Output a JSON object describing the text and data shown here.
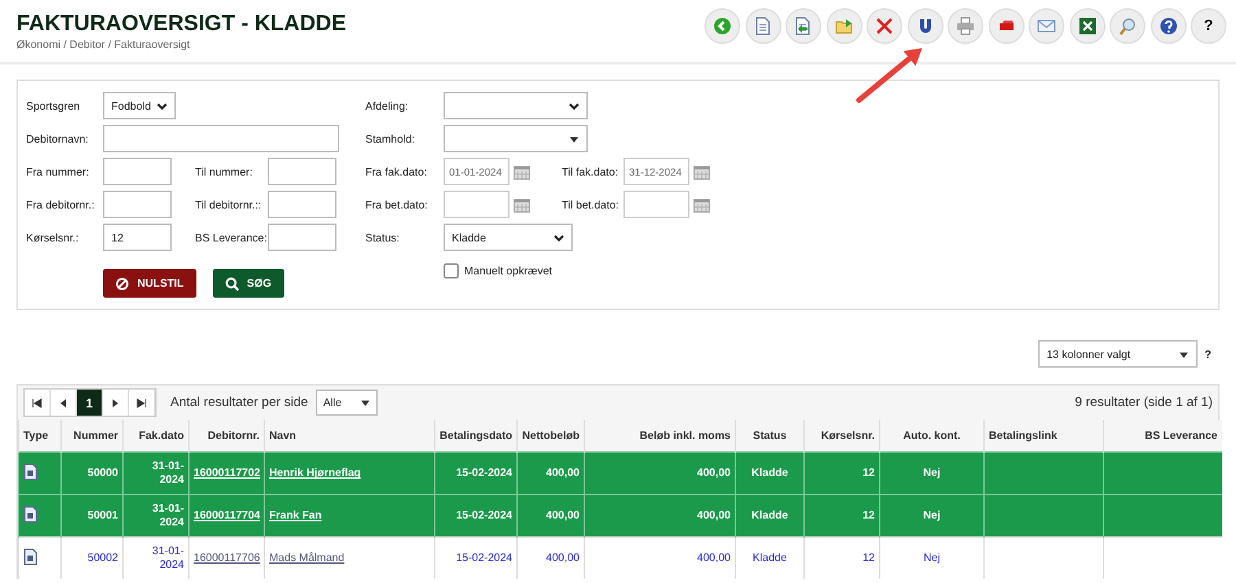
{
  "page": {
    "title": "FAKTURAOVERSIGT - KLADDE",
    "breadcrumb": "Økonomi / Debitor / Fakturaoversigt"
  },
  "toolbar": [
    {
      "pointed_at": false
    },
    {
      "pointed_at": false
    },
    {
      "pointed_at": false
    },
    {
      "pointed_at": false
    },
    {
      "pointed_at": false
    },
    {
      "pointed_at": true
    },
    {
      "pointed_at": false
    },
    {
      "pointed_at": false
    },
    {
      "pointed_at": false
    },
    {
      "pointed_at": false
    },
    {
      "pointed_at": false
    },
    {
      "pointed_at": false
    },
    {
      "pointed_at": false,
      "label": "?"
    }
  ],
  "filters": {
    "left_rows": [
      [
        {
          "label": "Sportsgren",
          "kind": "select",
          "value": "Fodbold"
        }
      ],
      [
        {
          "label": "Debitornavn:",
          "kind": "wide"
        }
      ],
      [
        {
          "label": "Fra nummer:",
          "kind": "text"
        },
        {
          "label": "Til nummer:",
          "kind": "text"
        }
      ],
      [
        {
          "label": "Fra debitornr.:",
          "kind": "text"
        },
        {
          "label": "Til debitornr.::",
          "kind": "text"
        }
      ],
      [
        {
          "label": "Kørselsnr.:",
          "kind": "text",
          "value": "12"
        },
        {
          "label": "BS Leverance:",
          "kind": "text"
        }
      ]
    ],
    "right_rows": [
      [
        {
          "label": "Afdeling:",
          "kind": "select"
        }
      ],
      [
        {
          "label": "Stamhold:",
          "kind": "combo"
        }
      ],
      [
        {
          "label": "Fra fak.dato:",
          "kind": "date",
          "value": "01-01-2024"
        },
        {
          "label": "Til fak.dato:",
          "kind": "date",
          "value": "31-12-2024"
        }
      ],
      [
        {
          "label": "Fra bet.dato:",
          "kind": "date"
        },
        {
          "label": "Til bet.dato:",
          "kind": "date"
        }
      ],
      [
        {
          "label": "Status:",
          "kind": "status",
          "value": "Kladde"
        }
      ],
      [
        {
          "label": "Manuelt opkrævet",
          "kind": "checkbox",
          "checked": false
        }
      ]
    ],
    "buttons": [
      {
        "label": "NULSTIL",
        "kind": "reset"
      },
      {
        "label": "SØG",
        "kind": "search"
      }
    ]
  },
  "column_picker": {
    "value": "13 kolonner valgt",
    "help": "?"
  },
  "pagination": {
    "pages": [
      {
        "label": "1",
        "selected": true
      }
    ],
    "per_page_label": "Antal resultater per side",
    "per_page": "Alle",
    "summary": "9 resultater (side 1 af 1)"
  },
  "table": {
    "columns": [
      "Type",
      "Nummer",
      "Fak.dato",
      "Debitornr.",
      "Navn",
      "Betalingsdato",
      "Nettobeløb",
      "Beløb inkl. moms",
      "Status",
      "Kørselsnr.",
      "Auto. kont.",
      "Betalingslink",
      "BS Leverance"
    ],
    "rows": [
      {
        "selected": true,
        "cells": [
          "",
          "50000",
          "31-01-2024",
          "16000117702",
          "Henrik Hjørneflag",
          "15-02-2024",
          "400,00",
          "400,00",
          "Kladde",
          "12",
          "Nej"
        ]
      },
      {
        "selected": true,
        "cells": [
          "",
          "50001",
          "31-01-2024",
          "16000117704",
          "Frank Fan",
          "15-02-2024",
          "400,00",
          "400,00",
          "Kladde",
          "12",
          "Nej"
        ]
      },
      {
        "selected": false,
        "cells": [
          "",
          "50002",
          "31-01-2024",
          "16000117706",
          "Mads Målmand",
          "15-02-2024",
          "400,00",
          "400,00",
          "Kladde",
          "12",
          "Nej"
        ]
      }
    ]
  }
}
